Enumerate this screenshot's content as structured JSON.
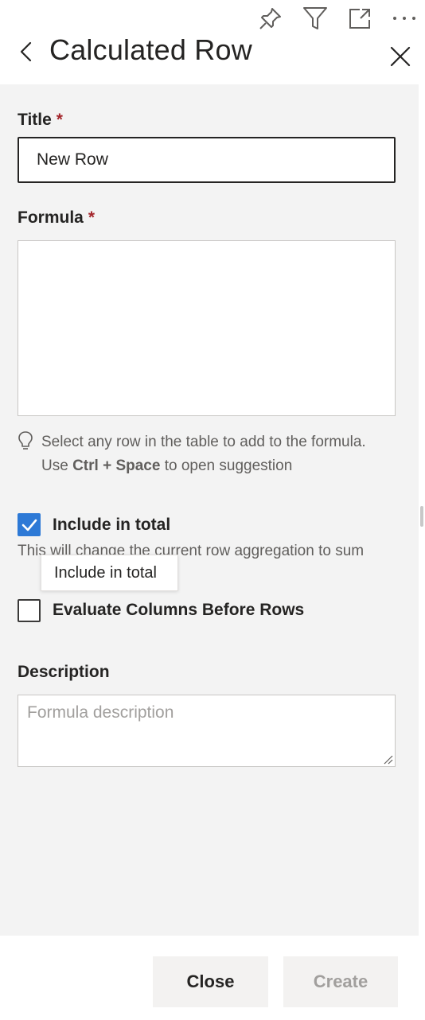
{
  "header": {
    "title": "Calculated Row",
    "icons": [
      "pin-icon",
      "filter-icon",
      "focus-mode-icon",
      "more-options-icon",
      "back-icon",
      "close-icon"
    ]
  },
  "form": {
    "title_label": "Title",
    "title_required": "*",
    "title_value": "New Row",
    "formula_label": "Formula",
    "formula_required": "*",
    "formula_value": "",
    "hint_line1": "Select any row in the table to add to the formula.",
    "hint_line2_pre": "Use ",
    "hint_line2_keys": "Ctrl + Space",
    "hint_line2_post": " to open suggestion",
    "include_total_label": "Include in total",
    "include_total_checked": true,
    "include_total_note": "This will change the current row aggregation to sum",
    "tooltip_text": "Include in total",
    "evaluate_label": "Evaluate Columns Before Rows",
    "evaluate_checked": false,
    "description_label": "Description",
    "description_placeholder": "Formula description"
  },
  "footer": {
    "close_label": "Close",
    "create_label": "Create"
  },
  "colors": {
    "accent": "#2d79d6",
    "required": "#a4262c",
    "panel_bg": "#f3f3f3",
    "disabled_text": "#a19f9d"
  }
}
